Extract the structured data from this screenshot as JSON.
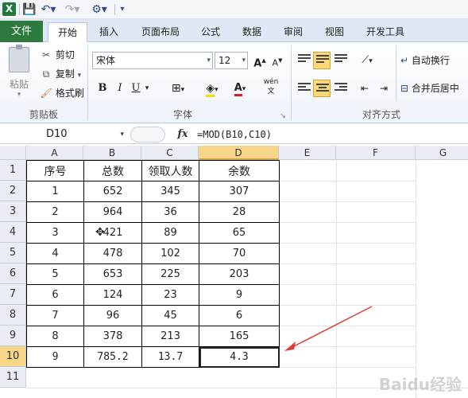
{
  "qat": {
    "app_icon": "X"
  },
  "tabs": {
    "file": "文件",
    "items": [
      "开始",
      "插入",
      "页面布局",
      "公式",
      "数据",
      "审阅",
      "视图",
      "开发工具"
    ]
  },
  "ribbon": {
    "clipboard": {
      "paste": "粘贴",
      "cut": "剪切",
      "copy": "复制",
      "format_painter": "格式刷",
      "label": "剪贴板"
    },
    "font": {
      "name": "宋体",
      "size": "12",
      "bold": "B",
      "italic": "I",
      "underline": "U",
      "font_color": "A",
      "phonetic": "wén",
      "label": "字体"
    },
    "alignment": {
      "wrap": "自动换行",
      "merge": "合并后居中",
      "label": "对齐方式"
    }
  },
  "formula_bar": {
    "name_box": "D10",
    "fx": "fx",
    "formula": "=MOD(B10,C10)"
  },
  "sheet": {
    "columns": [
      "A",
      "B",
      "C",
      "D",
      "E",
      "F",
      "G"
    ],
    "rows": [
      "1",
      "2",
      "3",
      "4",
      "5",
      "6",
      "7",
      "8",
      "9",
      "10",
      "11"
    ],
    "selected_cell": "D10",
    "table": [
      [
        "序号",
        "总数",
        "领取人数",
        "余数"
      ],
      [
        "1",
        "652",
        "345",
        "307"
      ],
      [
        "2",
        "964",
        "36",
        "28"
      ],
      [
        "3",
        "421",
        "89",
        "65"
      ],
      [
        "4",
        "478",
        "102",
        "70"
      ],
      [
        "5",
        "653",
        "225",
        "203"
      ],
      [
        "6",
        "124",
        "23",
        "9"
      ],
      [
        "7",
        "96",
        "45",
        "6"
      ],
      [
        "8",
        "378",
        "213",
        "165"
      ],
      [
        "9",
        "785.2",
        "13.7",
        "4.3"
      ]
    ]
  },
  "colors": {
    "file_tab": "#2c7a3e",
    "selection": "#f7d68a",
    "arrow": "#e03a3a"
  },
  "watermark": "Baidu经验"
}
